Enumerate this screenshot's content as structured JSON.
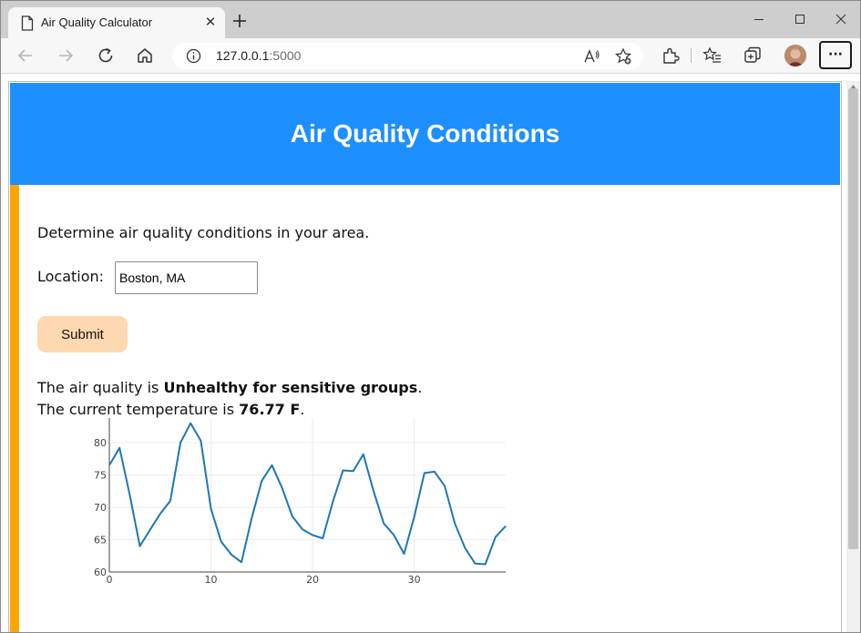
{
  "browser": {
    "tab_title": "Air Quality Calculator",
    "tab_close": "✕",
    "url_host": "127.0.0.1",
    "url_port": ":5000",
    "more_label": "···"
  },
  "page": {
    "title": "Air Quality Conditions",
    "description": "Determine air quality conditions in your area.",
    "location_label": "Location:",
    "location_value": "Boston, MA",
    "submit_label": "Submit",
    "aq_prefix": "The air quality is ",
    "aq_value": "Unhealthy for sensitive groups",
    "aq_suffix": ".",
    "temp_prefix": "The current temperature is ",
    "temp_value": "76.77 F",
    "temp_suffix": "."
  },
  "colors": {
    "header": "#1e8fff",
    "accent_bar": "#ffa500",
    "submit_bg": "#fed8b1",
    "line": "#1f77b4"
  },
  "icons": [
    "page-icon",
    "plus-icon",
    "minimize-icon",
    "maximize-icon",
    "close-icon",
    "back-arrow-icon",
    "forward-arrow-icon",
    "refresh-icon",
    "home-icon",
    "info-icon",
    "read-aloud-icon",
    "add-favorite-icon",
    "extensions-icon",
    "favorites-icon",
    "collections-icon",
    "profile-avatar",
    "more-icon"
  ],
  "chart_data": {
    "type": "line",
    "title": "",
    "xlabel": "",
    "ylabel": "",
    "xlim": [
      0,
      39
    ],
    "ylim": [
      60,
      83.8
    ],
    "x_ticks": [
      0,
      10,
      20,
      30
    ],
    "y_ticks": [
      60,
      65,
      70,
      75,
      80
    ],
    "grid": true,
    "x": [
      0,
      1,
      2,
      3,
      4,
      5,
      6,
      7,
      8,
      9,
      10,
      11,
      12,
      13,
      14,
      15,
      16,
      17,
      18,
      19,
      20,
      21,
      22,
      23,
      24,
      25,
      26,
      27,
      28,
      29,
      30,
      31,
      32,
      33,
      34,
      35,
      36,
      37,
      38,
      39
    ],
    "series": [
      {
        "values": [
          76.5,
          79.2,
          72.0,
          64.0,
          66.5,
          69.0,
          71.0,
          80.0,
          83.0,
          80.3,
          69.8,
          64.7,
          62.7,
          61.5,
          68.3,
          74.1,
          76.5,
          73.0,
          68.6,
          66.6,
          65.7,
          65.2,
          70.9,
          75.7,
          75.6,
          78.2,
          72.5,
          67.5,
          65.7,
          62.8,
          68.5,
          75.3,
          75.5,
          73.3,
          67.5,
          63.7,
          61.3,
          61.2,
          65.4,
          67.1
        ]
      }
    ]
  }
}
